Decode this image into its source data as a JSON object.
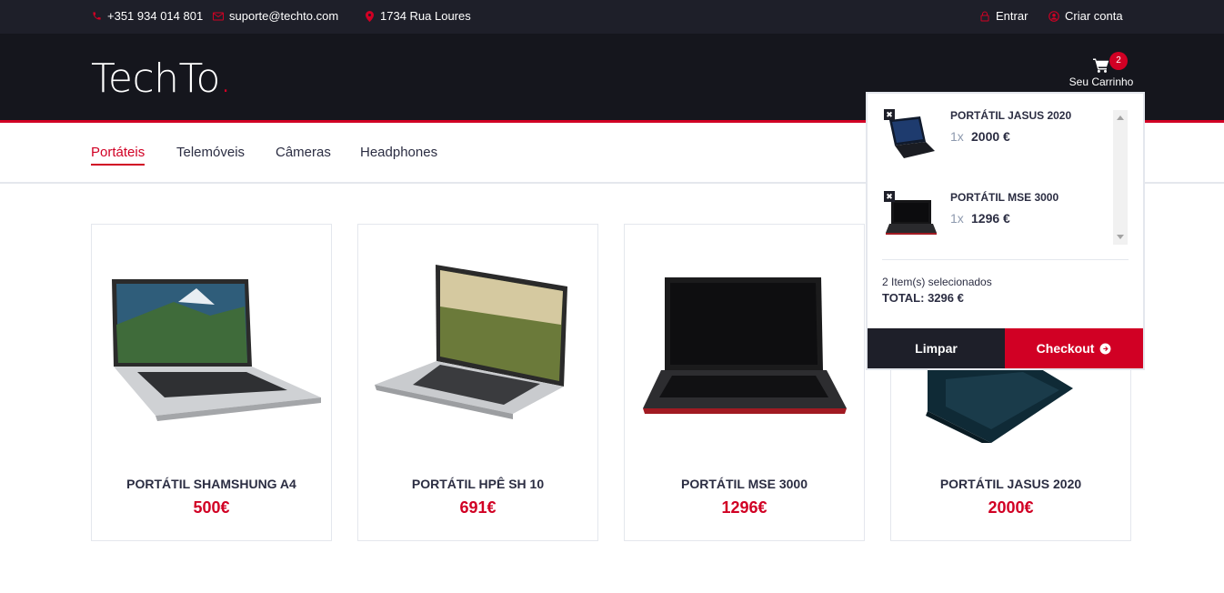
{
  "topbar": {
    "phone": "+351 934 014 801",
    "email": "suporte@techto.com",
    "address": "1734 Rua Loures",
    "login": "Entrar",
    "register": "Criar conta"
  },
  "header": {
    "logo_text": "TechTo",
    "logo_dot": ".",
    "cart_label": "Seu Carrinho",
    "cart_count": "2"
  },
  "nav": {
    "items": [
      {
        "label": "Portáteis",
        "active": true
      },
      {
        "label": "Telemóveis"
      },
      {
        "label": "Câmeras"
      },
      {
        "label": "Headphones"
      }
    ]
  },
  "products": [
    {
      "name": "PORTÁTIL SHAMSHUNG A4",
      "price": "500€"
    },
    {
      "name": "PORTÁTIL HPÊ SH 10",
      "price": "691€"
    },
    {
      "name": "PORTÁTIL MSE 3000",
      "price": "1296€"
    },
    {
      "name": "PORTÁTIL JASUS 2020",
      "price": "2000€"
    }
  ],
  "cart": {
    "items": [
      {
        "name": "PORTÁTIL JASUS 2020",
        "qty": "1x",
        "price": "2000 €"
      },
      {
        "name": "PORTÁTIL MSE 3000",
        "qty": "1x",
        "price": "1296 €"
      }
    ],
    "remove_icon": "✖",
    "summary": "2 Item(s) selecionados",
    "total": "TOTAL: 3296 €",
    "clear_label": "Limpar",
    "checkout_label": "Checkout"
  },
  "colors": {
    "accent": "#d10024",
    "dark": "#15161d",
    "topbar": "#1e1f29"
  }
}
